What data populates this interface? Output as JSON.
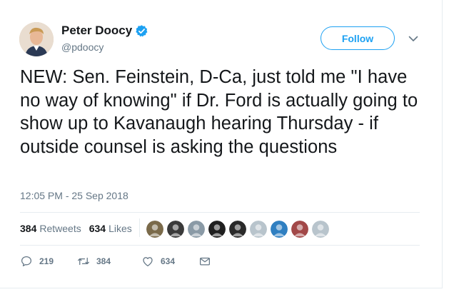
{
  "user": {
    "display_name": "Peter Doocy",
    "handle": "@pdoocy",
    "verified": true
  },
  "follow_label": "Follow",
  "tweet": {
    "text": "NEW: Sen. Feinstein, D-Ca, just told me \"I have no way of knowing\" if Dr. Ford is actually going to show up to Kavanaugh hearing Thursday - if outside counsel is asking the questions",
    "timestamp": "12:05 PM - 25 Sep 2018"
  },
  "stats": {
    "retweets_count": "384",
    "retweets_label": "Retweets",
    "likes_count": "634",
    "likes_label": "Likes"
  },
  "liker_avatars": [
    "#7a6a4a",
    "#3a3a3a",
    "#8a9aa6",
    "#1f1f1f",
    "#2a2a2a",
    "#b8c4cc",
    "#2f7fc1",
    "#a24848",
    "#b8c4cc"
  ],
  "actions": {
    "reply_count": "219",
    "retweet_count": "384",
    "like_count": "634"
  },
  "colors": {
    "accent": "#1da1f2",
    "muted": "#657786",
    "text": "#14171a",
    "border": "#e6ecf0"
  }
}
